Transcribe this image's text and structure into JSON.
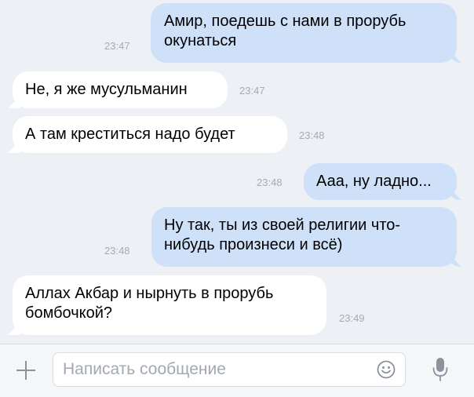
{
  "messages": [
    {
      "direction": "out",
      "text": "Амир, поедешь с нами в прорубь\nокунаться",
      "time": "23:47"
    },
    {
      "direction": "in",
      "text": "Не, я же мусульманин",
      "time": "23:47"
    },
    {
      "direction": "in",
      "text": "А там креститься надо будет",
      "time": "23:48"
    },
    {
      "direction": "out",
      "text": "Ааа, ну ладно...",
      "time": "23:48"
    },
    {
      "direction": "out",
      "text": "Ну так, ты из своей религии что-\nнибудь произнеси и всё)",
      "time": "23:48"
    },
    {
      "direction": "in",
      "text": "Аллах Акбар и нырнуть в прорубь\nбомбочкой?",
      "time": "23:49"
    }
  ],
  "composer": {
    "placeholder": "Написать сообщение",
    "value": "",
    "attach_icon": "plus-icon",
    "emoji_icon": "smiley-icon",
    "mic_icon": "microphone-icon"
  },
  "colors": {
    "background": "#edf0f5",
    "outgoing_bubble": "#cfe0f9",
    "incoming_bubble": "#ffffff",
    "timestamp": "#a7acb3",
    "icon": "#8c939c"
  }
}
